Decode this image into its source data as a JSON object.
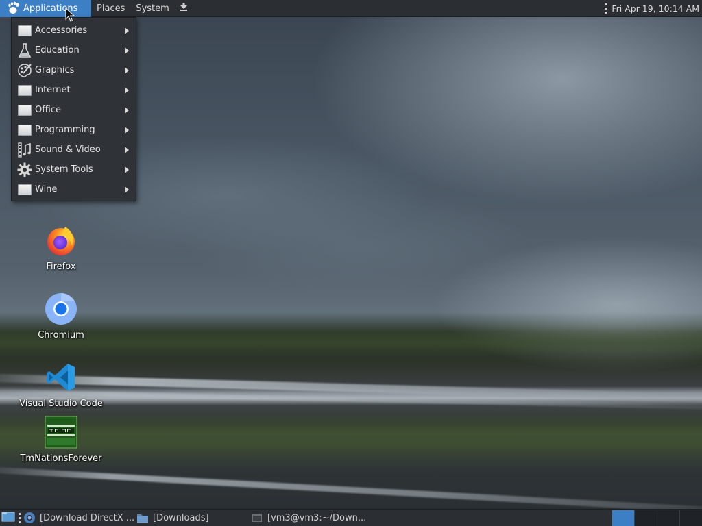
{
  "top_panel": {
    "menus": [
      "Applications",
      "Places",
      "System"
    ],
    "clock": "Fri Apr 19, 10:14 AM"
  },
  "apps_menu": {
    "items": [
      {
        "label": "Accessories",
        "icon": "accessories-icon"
      },
      {
        "label": "Education",
        "icon": "flask-icon"
      },
      {
        "label": "Graphics",
        "icon": "palette-icon"
      },
      {
        "label": "Internet",
        "icon": "internet-icon"
      },
      {
        "label": "Office",
        "icon": "office-icon"
      },
      {
        "label": "Programming",
        "icon": "programming-icon"
      },
      {
        "label": "Sound & Video",
        "icon": "film-icon"
      },
      {
        "label": "System Tools",
        "icon": "gear-icon"
      },
      {
        "label": "Wine",
        "icon": "wine-icon"
      }
    ]
  },
  "desktop": {
    "icons": [
      {
        "label": "Firefox",
        "icon": "firefox-icon"
      },
      {
        "label": "Chromium",
        "icon": "chromium-icon"
      },
      {
        "label": "Visual Studio Code",
        "icon": "vscode-icon"
      },
      {
        "label": "TmNationsForever",
        "icon": "tmnations-icon"
      }
    ]
  },
  "taskbar": {
    "tasks": [
      {
        "label": "[Download DirectX ...",
        "icon": "browser-icon"
      },
      {
        "label": "[Downloads]",
        "icon": "folder-icon"
      },
      {
        "label": "[vm3@vm3:~/Down...",
        "icon": "terminal-icon"
      }
    ],
    "workspaces": 4,
    "active_workspace": 1
  },
  "colors": {
    "panel": "#2b2e33",
    "accent": "#3d7fc4",
    "menu_bg": "#2f3237"
  }
}
